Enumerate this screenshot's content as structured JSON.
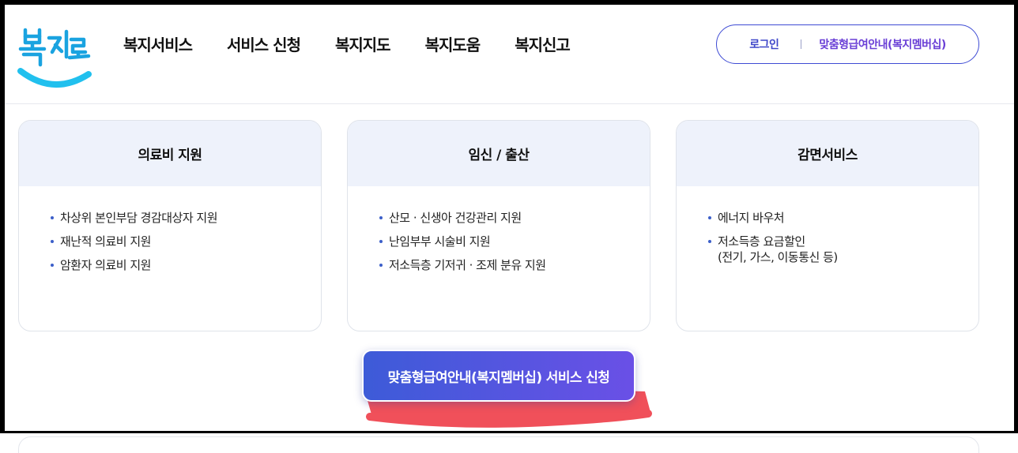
{
  "logo": {
    "text": "복지로",
    "icon": "bokjiro-logo"
  },
  "nav": {
    "items": [
      {
        "label": "복지서비스"
      },
      {
        "label": "서비스 신청"
      },
      {
        "label": "복지지도"
      },
      {
        "label": "복지도움"
      },
      {
        "label": "복지신고"
      }
    ]
  },
  "util": {
    "login": "로그인",
    "membership": "맞춤형급여안내(복지멤버십)"
  },
  "cards": [
    {
      "title": "의료비 지원",
      "items": [
        "차상위 본인부담 경감대상자 지원",
        "재난적 의료비 지원",
        "암환자 의료비 지원"
      ]
    },
    {
      "title": "임신 / 출산",
      "items": [
        "산모 · 신생아 건강관리 지원",
        "난임부부 시술비 지원",
        "저소득층 기저귀 · 조제 분유 지원"
      ]
    },
    {
      "title": "감면서비스",
      "items": [
        "에너지 바우처",
        "저소득층 요금할인",
        "(전기, 가스, 이동통신 등)"
      ]
    }
  ],
  "cta": {
    "label": "맞춤형급여안내(복지멤버십) 서비스 신청"
  },
  "colors": {
    "accent": "#3e46c9",
    "accent2": "#6a3fd6",
    "card_head": "#eef2fb",
    "logo_blue": "#1aa3e0",
    "logo_cyan": "#21c0ee",
    "annotation_red": "#f0505a"
  }
}
